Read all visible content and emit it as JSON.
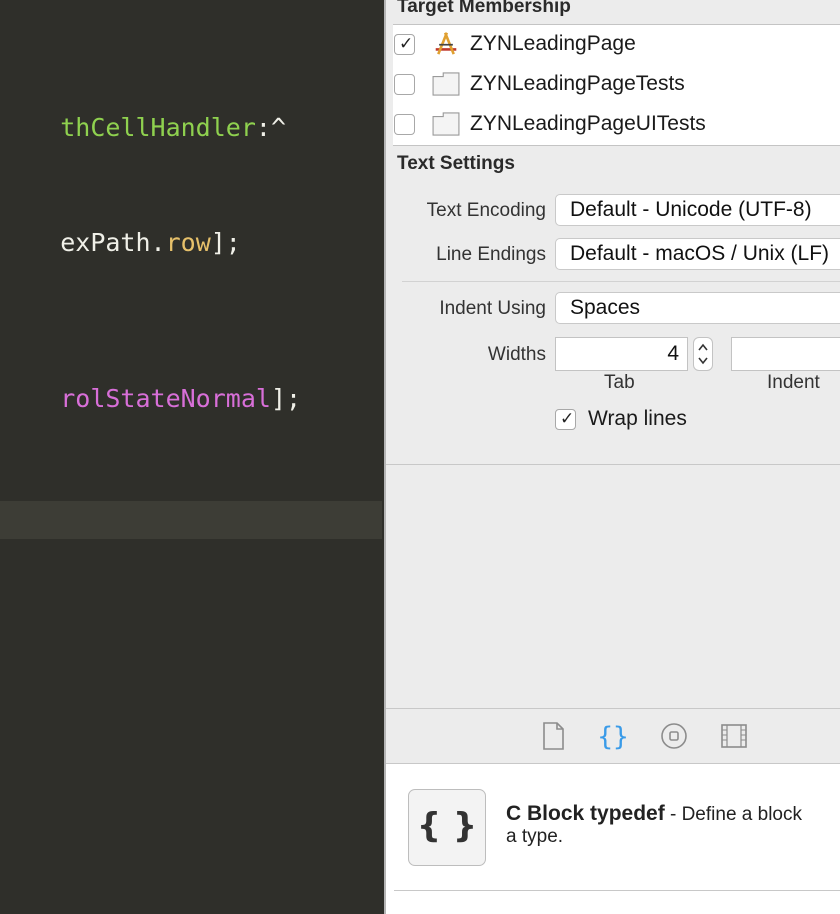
{
  "editor": {
    "lines": [
      {
        "parts": [
          {
            "text": "thCellHandler",
            "color": "#8fd14f"
          },
          {
            "text": ":^",
            "color": "#f0f0e8"
          }
        ]
      },
      {
        "parts": [
          {
            "text": "exPath",
            "color": "#f0f0e8"
          },
          {
            "text": ".",
            "color": "#f0f0e8"
          },
          {
            "text": "row",
            "color": "#e6c06a"
          },
          {
            "text": "];",
            "color": "#f0f0e8"
          }
        ]
      },
      {
        "parts": [
          {
            "text": "rolStateNormal",
            "color": "#d86fd8"
          },
          {
            "text": "];",
            "color": "#f0f0e8"
          }
        ]
      }
    ]
  },
  "inspector": {
    "target_membership": {
      "title": "Target Membership",
      "targets": [
        {
          "name": "ZYNLeadingPage",
          "checked": true,
          "icon": "app-target-icon"
        },
        {
          "name": "ZYNLeadingPageTests",
          "checked": false,
          "icon": "test-bundle-icon"
        },
        {
          "name": "ZYNLeadingPageUITests",
          "checked": false,
          "icon": "test-bundle-icon"
        }
      ]
    },
    "text_settings": {
      "title": "Text Settings",
      "encoding_label": "Text Encoding",
      "encoding_value": "Default - Unicode (UTF-8)",
      "line_endings_label": "Line Endings",
      "line_endings_value": "Default - macOS / Unix (LF)",
      "indent_using_label": "Indent Using",
      "indent_using_value": "Spaces",
      "widths_label": "Widths",
      "tab_width": "4",
      "indent_width": "",
      "tab_caption": "Tab",
      "indent_caption": "Indent",
      "wrap_lines_label": "Wrap lines",
      "wrap_lines_checked": true
    }
  },
  "library": {
    "tabs": [
      {
        "name": "file-template",
        "icon": "document-icon",
        "selected": false
      },
      {
        "name": "code-snippet",
        "icon": "braces-icon",
        "selected": true
      },
      {
        "name": "object",
        "icon": "circle-object-icon",
        "selected": false
      },
      {
        "name": "media",
        "icon": "film-strip-icon",
        "selected": false
      }
    ],
    "snippet": {
      "icon_text": "{ }",
      "title": "C Block typedef",
      "description_line1": " - Define a block",
      "description_line2": "a type."
    }
  },
  "colors": {
    "editor_bg": "#2f2f2a",
    "selected_tab": "#3a9be8"
  }
}
